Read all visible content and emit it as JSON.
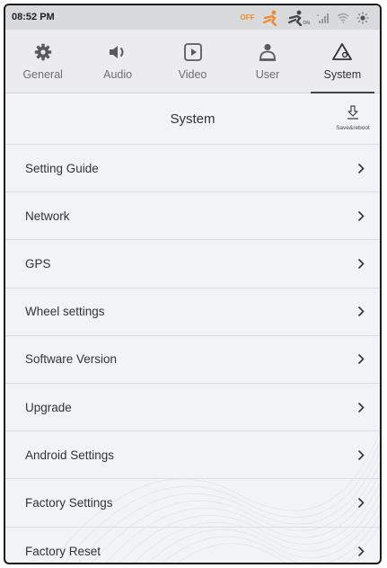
{
  "status_bar": {
    "time": "08:52 PM",
    "airbag_off_text": "OFF",
    "airbag_on_text": "ON",
    "icons": [
      "airbag-off-icon",
      "airbag-on-icon",
      "cellular-signal-icon",
      "wifi-icon",
      "brightness-icon"
    ],
    "off_color": "#f08a2c"
  },
  "tabs": [
    {
      "label": "General",
      "icon": "gear-icon",
      "active": false
    },
    {
      "label": "Audio",
      "icon": "speaker-icon",
      "active": false
    },
    {
      "label": "Video",
      "icon": "play-icon",
      "active": false
    },
    {
      "label": "User",
      "icon": "user-icon",
      "active": false
    },
    {
      "label": "System",
      "icon": "system-icon",
      "active": true
    }
  ],
  "header": {
    "title": "System",
    "save_reboot_label": "Save&reboot",
    "save_reboot_icon": "download-icon"
  },
  "list": {
    "items": [
      {
        "label": "Setting Guide"
      },
      {
        "label": "Network"
      },
      {
        "label": "GPS"
      },
      {
        "label": "Wheel settings"
      },
      {
        "label": "Software Version"
      },
      {
        "label": "Upgrade"
      },
      {
        "label": "Android Settings"
      },
      {
        "label": "Factory Settings"
      },
      {
        "label": "Factory Reset"
      }
    ],
    "chevron_icon": "chevron-right-icon"
  }
}
